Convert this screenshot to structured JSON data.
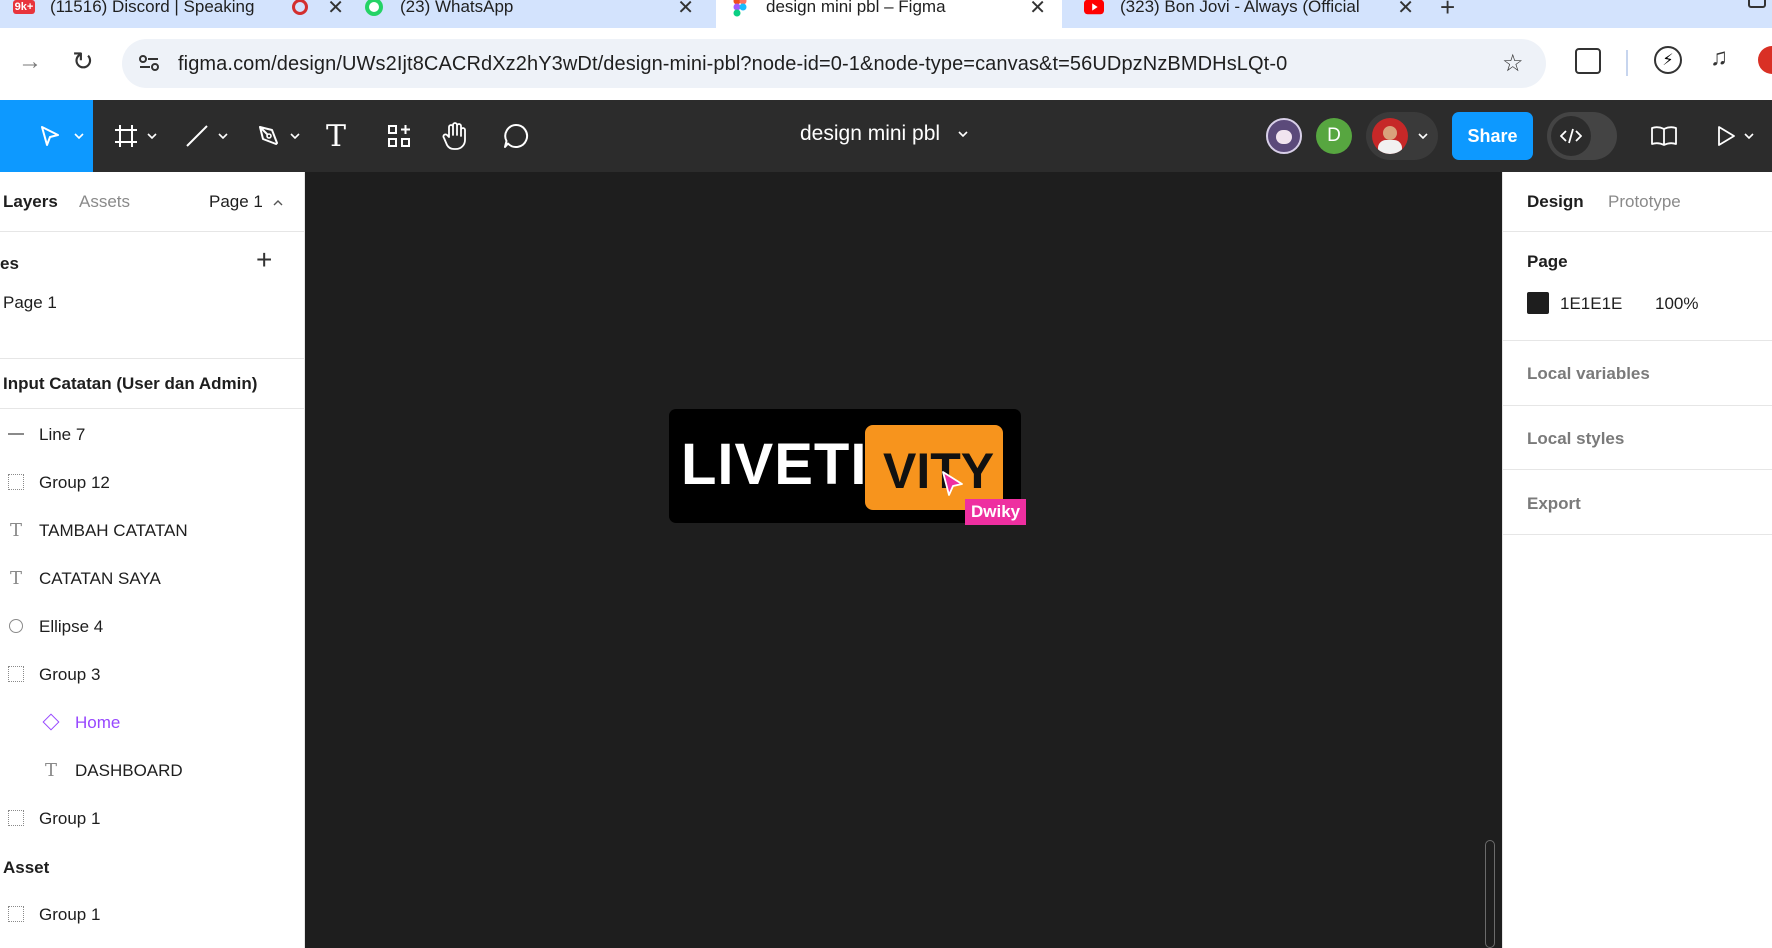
{
  "browser": {
    "tabs": [
      {
        "title": "(11516) Discord | Speaking",
        "badge": "9k+",
        "active": false
      },
      {
        "title": "(23) WhatsApp",
        "active": false
      },
      {
        "title": "design mini pbl – Figma",
        "active": true
      },
      {
        "title": "(323) Bon Jovi - Always (Official",
        "active": false
      }
    ],
    "url": "figma.com/design/UWs2Ijt8CACRdXz2hY3wDt/design-mini-pbl?node-id=0-1&node-type=canvas&t=56UDpzNzBMDHsLQt-0"
  },
  "figma_toolbar": {
    "file_title": "design mini pbl",
    "avatar_initial": "D",
    "share_label": "Share"
  },
  "left_panel": {
    "tabs": {
      "layers": "Layers",
      "assets": "Assets"
    },
    "page_selector": "Page 1",
    "pages_header": "es",
    "pages": [
      "Page 1"
    ],
    "frame_title": "Input Catatan (User dan Admin)",
    "layers": [
      {
        "name": "Line 7",
        "icon": "line-icon",
        "indent": 0
      },
      {
        "name": "Group 12",
        "icon": "group-icon",
        "indent": 0
      },
      {
        "name": "TAMBAH CATATAN",
        "icon": "text-icon",
        "indent": 0
      },
      {
        "name": "CATATAN SAYA",
        "icon": "text-icon",
        "indent": 0
      },
      {
        "name": "Ellipse 4",
        "icon": "ellipse-icon",
        "indent": 0
      },
      {
        "name": "Group 3",
        "icon": "group-icon",
        "indent": 0
      },
      {
        "name": "Home",
        "icon": "component-instance-icon",
        "indent": 1,
        "color": "#9747ff"
      },
      {
        "name": "DASHBOARD",
        "icon": "text-icon",
        "indent": 1
      },
      {
        "name": "Group 1",
        "icon": "group-icon",
        "indent": 0
      }
    ],
    "asset_frame_title": "Asset",
    "asset_layers": [
      {
        "name": "Group 1",
        "icon": "group-icon"
      }
    ]
  },
  "canvas": {
    "logo_left": "LIVETI",
    "logo_right": "VITY",
    "cursor_user": "Dwiky",
    "colors": {
      "bg": "#1e1e1e",
      "logo_accent": "#f7941d",
      "cursor": "#ee2fa0"
    }
  },
  "right_panel": {
    "tabs": {
      "design": "Design",
      "prototype": "Prototype"
    },
    "page_label": "Page",
    "page_fill_hex": "1E1E1E",
    "page_fill_opacity": "100%",
    "sections": [
      "Local variables",
      "Local styles",
      "Export"
    ]
  }
}
